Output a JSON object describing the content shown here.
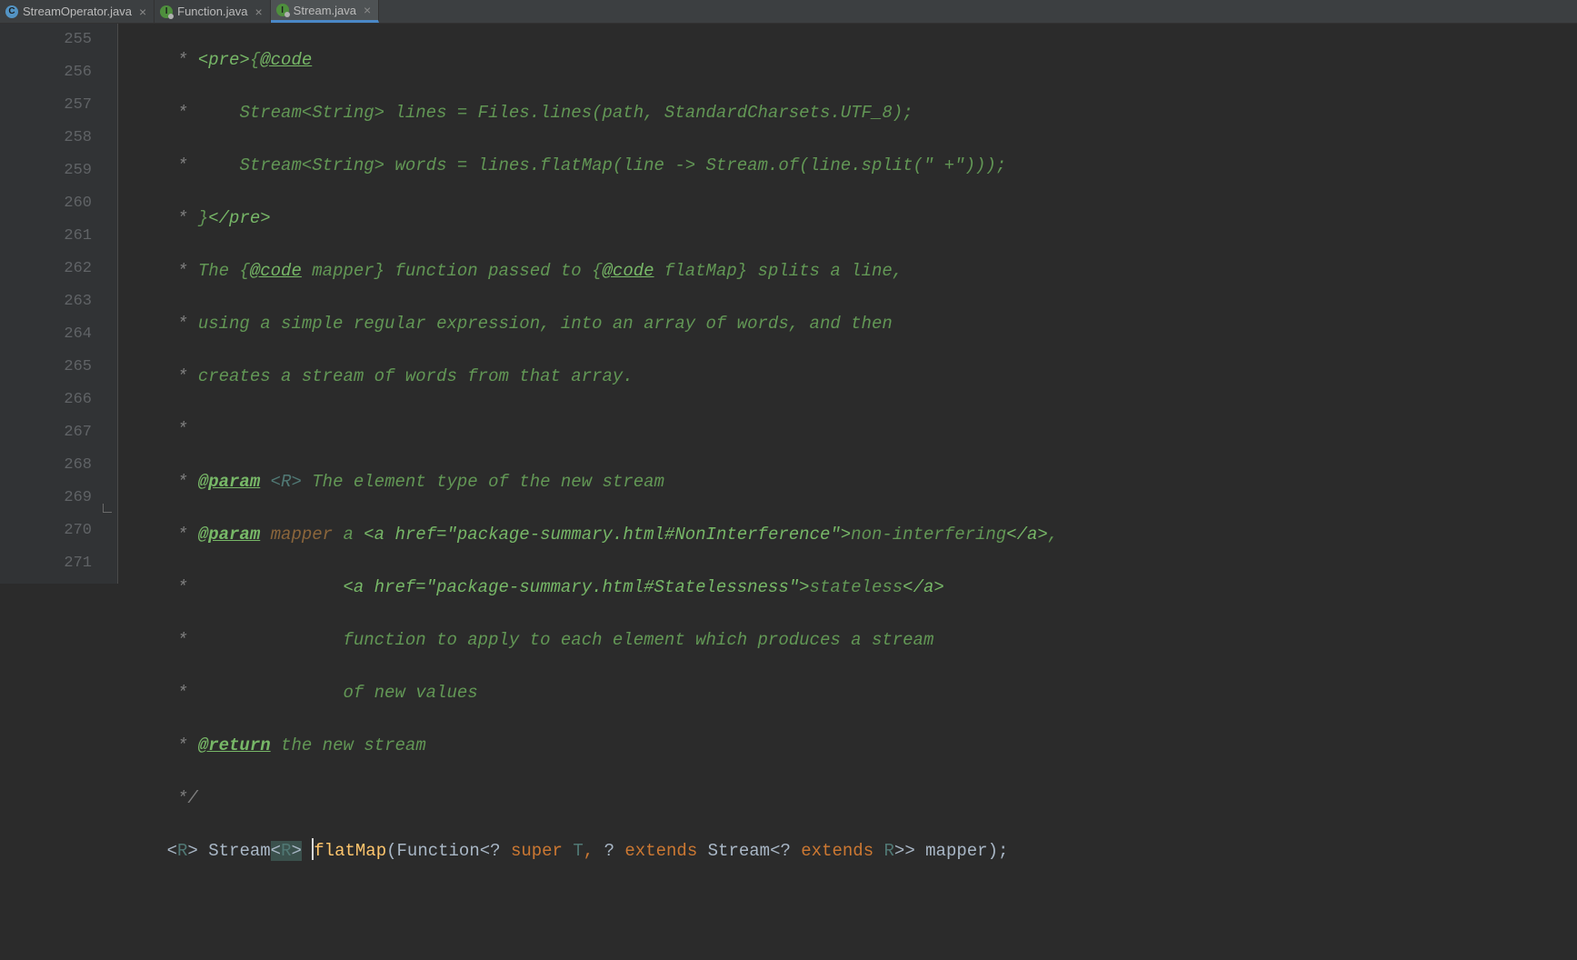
{
  "tabs": [
    {
      "label": "StreamOperator.java",
      "icon": "C",
      "active": false
    },
    {
      "label": "Function.java",
      "icon": "I",
      "active": false
    },
    {
      "label": "Stream.java",
      "icon": "I",
      "active": true
    }
  ],
  "gutter": {
    "start": 255,
    "end": 271,
    "impl_marker_line": 270,
    "fold_marker_line": 269
  },
  "code": {
    "l255": {
      "pre": "     ",
      "star": "*",
      "sp": " ",
      "t1": "<pre>",
      "t2": "{",
      "t3": "@code"
    },
    "l256": {
      "pre": "     ",
      "star": "*",
      "sp": "     ",
      "t": "Stream<String> lines = Files.lines(path, StandardCharsets.UTF_8);"
    },
    "l257": {
      "pre": "     ",
      "star": "*",
      "sp": "     ",
      "t": "Stream<String> words = lines.flatMap(line -> Stream.of(line.split(\" +\")));"
    },
    "l258": {
      "pre": "     ",
      "star": "*",
      "sp": " ",
      "t1": "}",
      "t2": "</pre>"
    },
    "l259": {
      "pre": "     ",
      "star": "*",
      "sp": " ",
      "t1": "The {",
      "t2": "@code",
      "t3": " mapper} function passed to {",
      "t4": "@code",
      "t5": " flatMap} splits a line,"
    },
    "l260": {
      "pre": "     ",
      "star": "*",
      "sp": " ",
      "t": "using a simple regular expression, into an array of words, and then"
    },
    "l261": {
      "pre": "     ",
      "star": "*",
      "sp": " ",
      "t": "creates a stream of words from that array."
    },
    "l262": {
      "pre": "     ",
      "star": "*"
    },
    "l263": {
      "pre": "     ",
      "star": "*",
      "sp": " ",
      "k": "@param",
      "gp": " <R> ",
      "t": "The element type of the new stream"
    },
    "l264": {
      "pre": "     ",
      "star": "*",
      "sp": " ",
      "k": "@param",
      "p": " mapper ",
      "t1": "a ",
      "a1o": "<a href=\"package-summary.html#NonInterference\">",
      "a1t": "non-interfering",
      "a1c": "</a>",
      "t2": ","
    },
    "l265": {
      "pre": "     ",
      "star": "*",
      "sp": "               ",
      "a2o": "<a href=\"package-summary.html#Statelessness\">",
      "a2t": "stateless",
      "a2c": "</a>"
    },
    "l266": {
      "pre": "     ",
      "star": "*",
      "sp": "               ",
      "t": "function to apply to each element which produces a stream"
    },
    "l267": {
      "pre": "     ",
      "star": "*",
      "sp": "               ",
      "t": "of new values"
    },
    "l268": {
      "pre": "     ",
      "star": "*",
      "sp": " ",
      "k": "@return",
      "t": " the new stream"
    },
    "l269": {
      "pre": "     ",
      "t": "*/"
    },
    "l270": {
      "pre": "    ",
      "lt1": "<",
      "tp1": "R",
      "gt1": "> ",
      "st": "Stream",
      "lt2": "<",
      "tp2": "R",
      "gt2": ">",
      "sp": " ",
      "mn": "flatMap",
      "op": "(",
      "fn": "Function",
      "lt3": "<",
      "q1": "?",
      "sp2": " ",
      "kw1": "super",
      "sp3": " ",
      "tp3": "T",
      "cm": ",",
      "sp4": " ",
      "q2": "?",
      "sp5": " ",
      "kw2": "extends",
      "sp6": " ",
      "st2": "Stream",
      "lt4": "<",
      "q3": "?",
      "sp7": " ",
      "kw3": "extends",
      "sp8": " ",
      "tp4": "R",
      "gt3": ">>",
      "sp9": " ",
      "mp": "mapper",
      "cp": ");"
    }
  }
}
